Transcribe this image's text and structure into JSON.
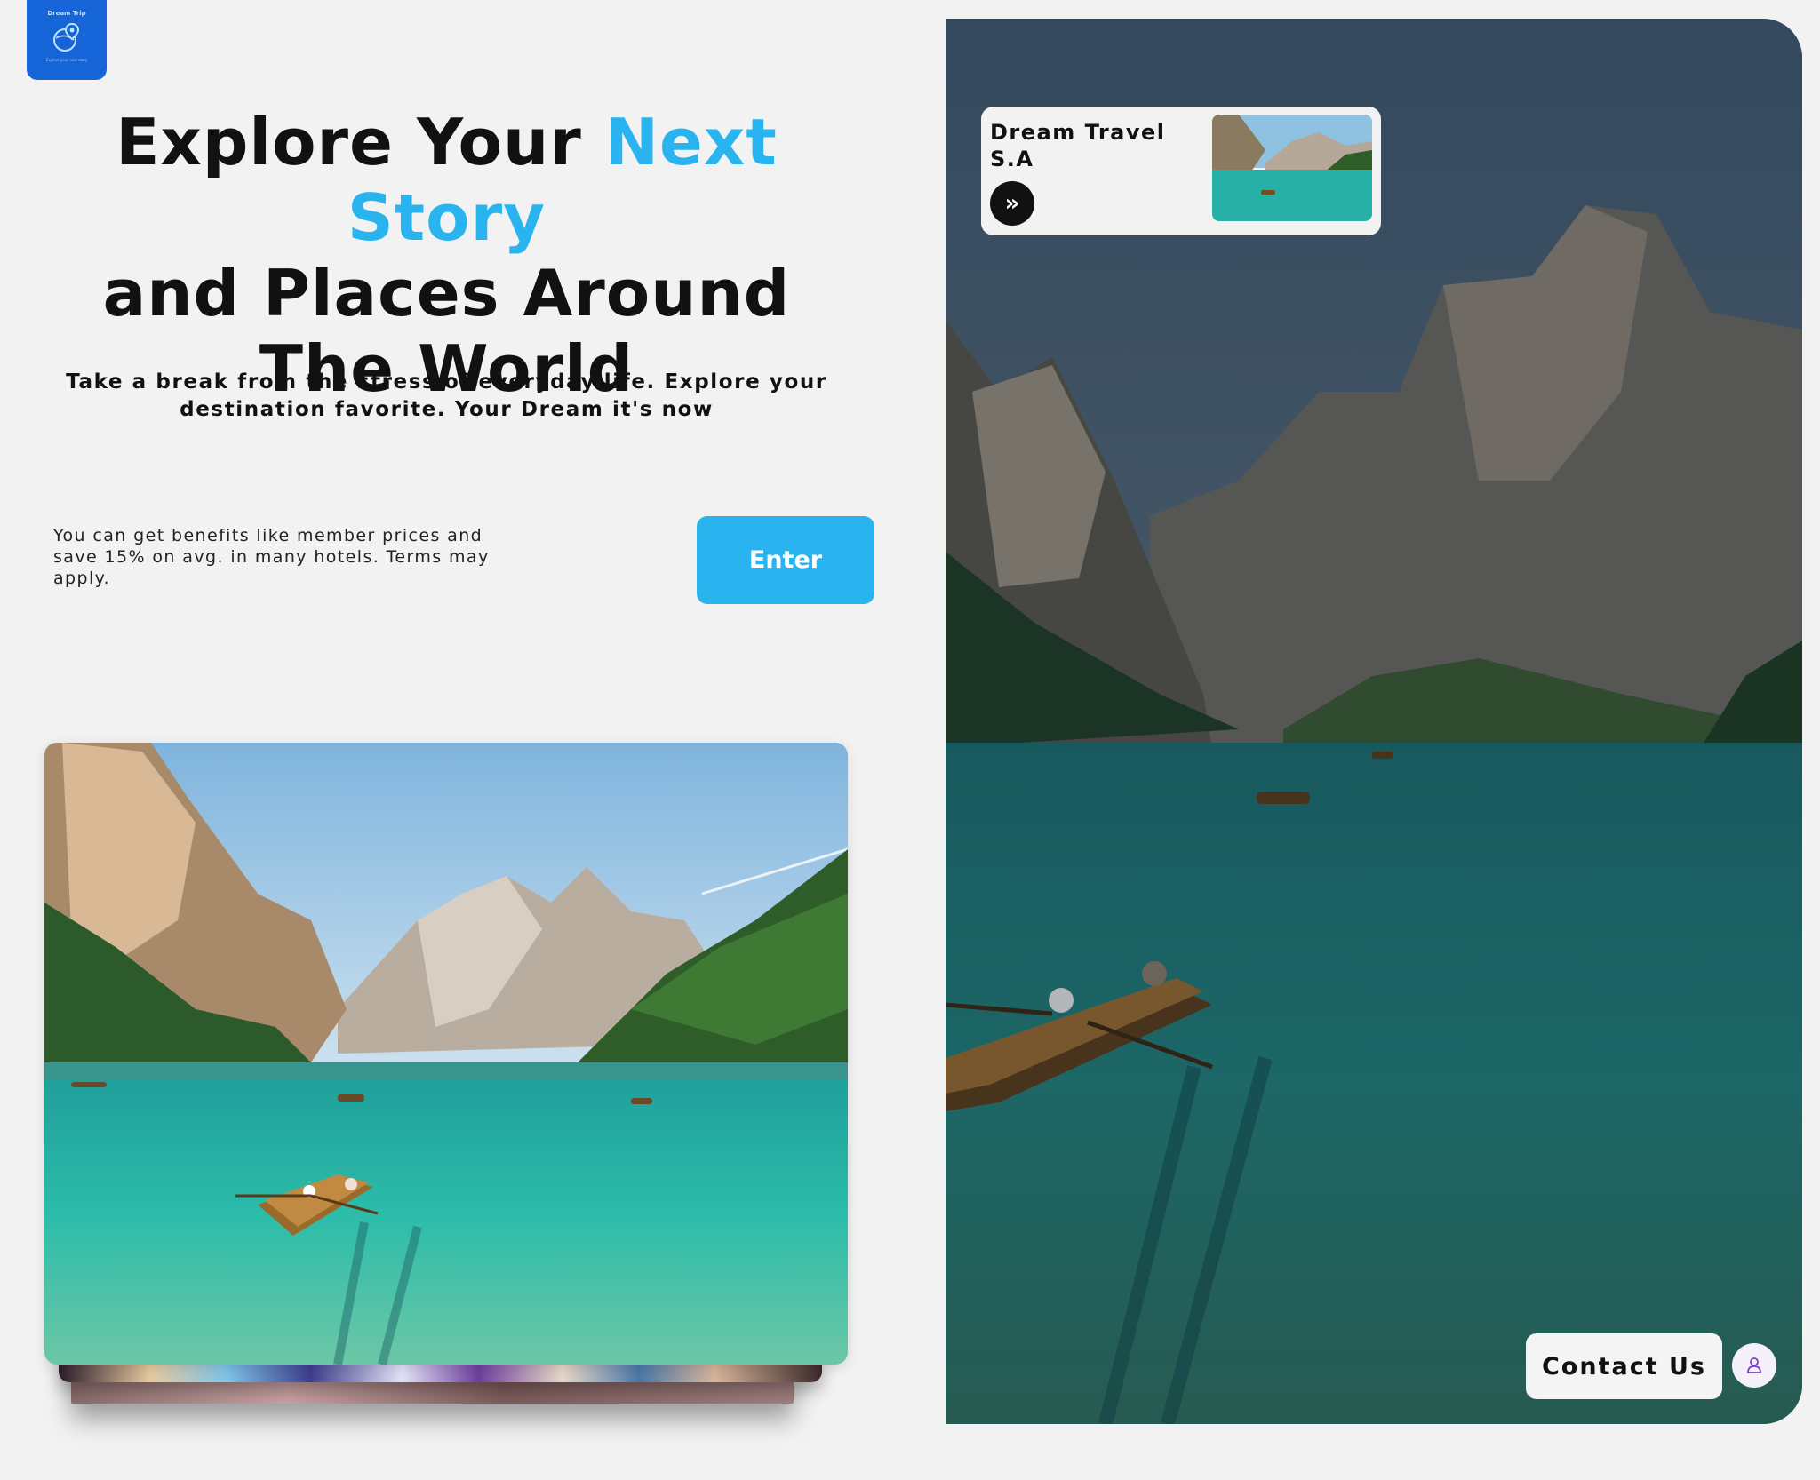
{
  "logo": {
    "title": "Dream Trip",
    "tagline": "Explore your next story"
  },
  "headline": {
    "line1_part1": "Explore Your ",
    "line1_accent": "Next Story",
    "line2": "and Places Around",
    "line3": "The World"
  },
  "subhead": "Take a break from the stress of everyday life. Explore your destination favorite. Your Dream it's now",
  "benefits": "You can get benefits like member prices and save 15% on avg. in many hotels. Terms may apply.",
  "enter_label": "Enter",
  "mini_card": {
    "title": "Dream Travel S.A",
    "button_icon": "double-chevron-right-icon"
  },
  "contact_label": "Contact Us",
  "colors": {
    "accent": "#29b4ef",
    "logo_bg": "#1565d8",
    "page_bg": "#f2f2f2",
    "text": "#111111"
  }
}
